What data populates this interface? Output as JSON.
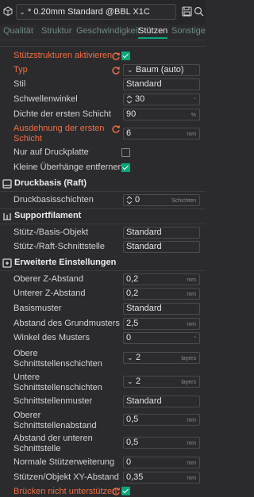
{
  "preset": {
    "label": "* 0.20mm Standard @BBL X1C"
  },
  "tabs": [
    {
      "label": "Qualität"
    },
    {
      "label": "Struktur"
    },
    {
      "label": "Geschwindigkeit"
    },
    {
      "label": "Stützen"
    },
    {
      "label": "Sonstiges"
    }
  ],
  "support": {
    "enable": {
      "label": "Stützstrukturen aktivieren",
      "checked": true
    },
    "type": {
      "label": "Typ",
      "value": "Baum (auto)"
    },
    "style": {
      "label": "Stil",
      "value": "Standard"
    },
    "threshold": {
      "label": "Schwellenwinkel",
      "value": "30",
      "unit": "°"
    },
    "first_layer_density": {
      "label": "Dichte der ersten Schicht",
      "value": "90",
      "unit": "%"
    },
    "first_layer_expansion": {
      "label": "Ausdehnung der ersten Schicht",
      "value": "6",
      "unit": "mm"
    },
    "on_build_plate": {
      "label": "Nur auf Druckplatte",
      "checked": false
    },
    "remove_small": {
      "label": "Kleine Überhänge entfernen",
      "checked": true
    }
  },
  "raft": {
    "title": "Druckbasis (Raft)",
    "layers": {
      "label": "Druckbasisschichten",
      "value": "0",
      "unit": "Schichten"
    }
  },
  "filament": {
    "title": "Supportfilament",
    "base_object": {
      "label": "Stütz-/Basis-Objekt",
      "value": "Standard"
    },
    "raft_interface": {
      "label": "Stütz-/Raft-Schnittstelle",
      "value": "Standard"
    }
  },
  "advanced": {
    "title": "Erweiterte Einstellungen",
    "top_z": {
      "label": "Oberer Z-Abstand",
      "value": "0,2",
      "unit": "mm"
    },
    "bottom_z": {
      "label": "Unterer Z-Abstand",
      "value": "0,2",
      "unit": "mm"
    },
    "base_pattern": {
      "label": "Basismuster",
      "value": "Standard"
    },
    "base_spacing": {
      "label": "Abstand des Grundmusters",
      "value": "2,5",
      "unit": "mm"
    },
    "pattern_angle": {
      "label": "Winkel des Musters",
      "value": "0",
      "unit": "°"
    },
    "top_interface_layers": {
      "label": "Obere Schnittstellenschichten",
      "value": "2",
      "unit": "layers"
    },
    "bottom_interface_layers": {
      "label": "Untere Schnittstellenschichten",
      "value": "2",
      "unit": "layers"
    },
    "interface_pattern": {
      "label": "Schnittstellenmuster",
      "value": "Standard"
    },
    "top_interface_spacing": {
      "label": "Oberer Schnittstellenabstand",
      "value": "0,5",
      "unit": "mm"
    },
    "bottom_interface_spacing": {
      "label": "Abstand der unteren Schnittstelle",
      "value": "0,5",
      "unit": "mm"
    },
    "normal_expansion": {
      "label": "Normale Stützerweiterung",
      "value": "0",
      "unit": "mm"
    },
    "xy_distance": {
      "label": "Stützen/Objekt XY-Abstand",
      "value": "0,35",
      "unit": "mm"
    },
    "bridge_no_support": {
      "label": "Brücken nicht unterstützen",
      "checked": true
    }
  },
  "colors": {
    "accent": "#09a77c",
    "modified": "#ef6f43",
    "background": "#2b2b2e"
  }
}
